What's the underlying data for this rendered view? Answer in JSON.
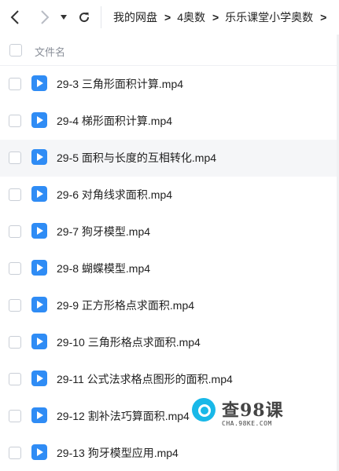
{
  "icons": {
    "back": "chevron-left-icon",
    "forward": "chevron-right-icon",
    "dropdown": "caret-down-icon",
    "refresh": "refresh-icon",
    "file": "video-file-icon"
  },
  "colors": {
    "accent": "#2f8cf5",
    "watermark_logo": "#19b8e8",
    "hover_row": "#f5f6f8"
  },
  "breadcrumb": {
    "items": [
      "我的网盘",
      "4奥数",
      "乐乐课堂小学奥数"
    ],
    "separator": ">"
  },
  "header": {
    "name_column": "文件名"
  },
  "files": [
    {
      "name": "29-3 三角形面积计算.mp4"
    },
    {
      "name": "29-4 梯形面积计算.mp4"
    },
    {
      "name": "29-5 面积与长度的互相转化.mp4"
    },
    {
      "name": "29-6 对角线求面积.mp4"
    },
    {
      "name": "29-7 狗牙模型.mp4"
    },
    {
      "name": "29-8 蝴蝶模型.mp4"
    },
    {
      "name": "29-9 正方形格点求面积.mp4"
    },
    {
      "name": "29-10 三角形格点求面积.mp4"
    },
    {
      "name": "29-11 公式法求格点图形的面积.mp4"
    },
    {
      "name": "29-12 割补法巧算面积.mp4"
    },
    {
      "name": "29-13 狗牙模型应用.mp4"
    }
  ],
  "watermark": {
    "title": "查98课",
    "subtitle": "CHA.98KE.COM"
  }
}
